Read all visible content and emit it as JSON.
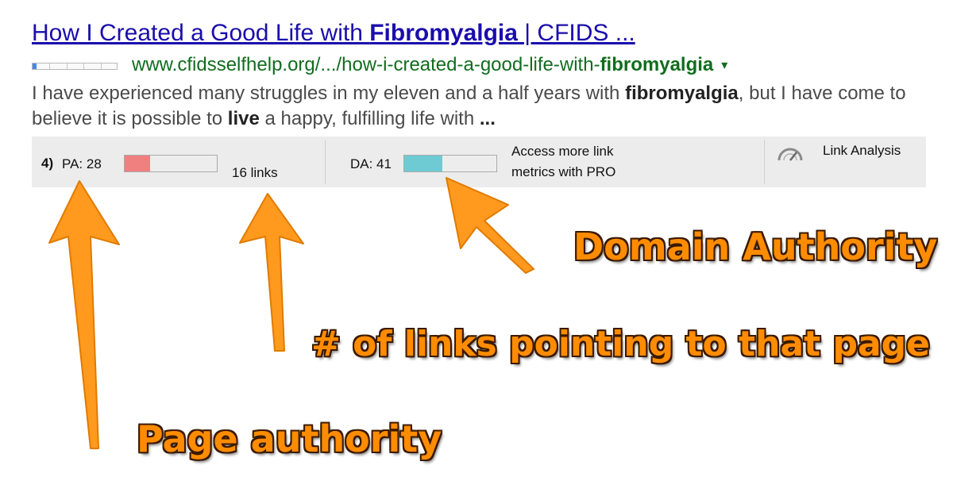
{
  "result": {
    "title_pre": "How I Created a Good Life with ",
    "title_bold": "Fibromyalgia",
    "title_post": " | CFIDS ...",
    "url_pre": "www.cfidsselfhelp.org/.../how-i-created-a-good-life-with-",
    "url_bold": "fibromyalgia",
    "caret": "▾",
    "snippet": {
      "p1": "I have experienced many struggles in my eleven and a half years with ",
      "b1": "fibromyalgia",
      "p2": ", but I have come to believe it is possible to ",
      "b2": "live",
      "p3": " a happy, fulfilling life with ",
      "b3": "..."
    }
  },
  "toolbar": {
    "rank": "4)",
    "pa_label": "PA: 28",
    "pa_fraction": 0.28,
    "pa_color": "#f08080",
    "links_label": "16 links",
    "da_label": "DA: 41",
    "da_fraction": 0.41,
    "da_color": "#6ecbd3",
    "pro_line1": "Access more link",
    "pro_line2": "metrics with PRO",
    "link_analysis": "Link Analysis",
    "gauge_icon": "gauge-icon"
  },
  "annotations": {
    "domain_authority": "Domain Authority",
    "links_pointing": "# of links pointing to that page",
    "page_authority": "Page authority",
    "color": "#ff8c00"
  }
}
